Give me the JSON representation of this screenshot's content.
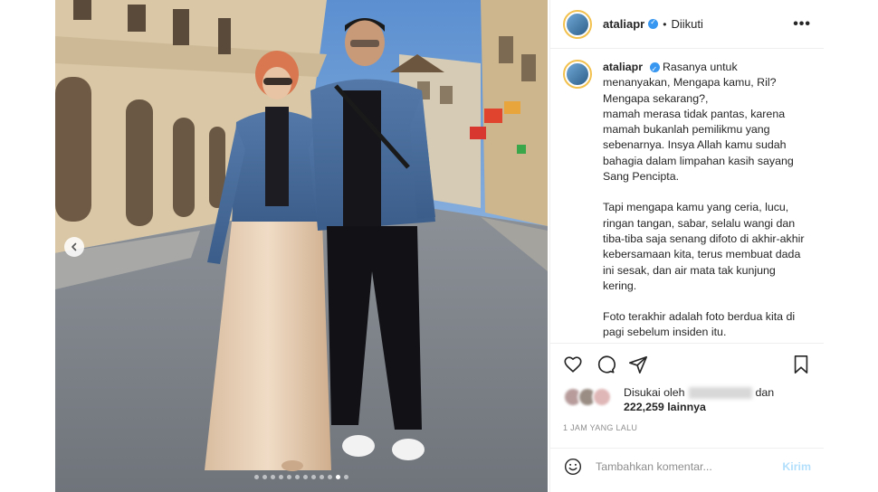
{
  "post": {
    "username": "ataliapr",
    "follow_state": "Diikuti",
    "separator": "•",
    "more_label": "•••",
    "caption": [
      "Rasanya untuk menanyakan, Mengapa kamu, Ril? Mengapa sekarang?,\nmamah merasa tidak pantas, karena mamah bukanlah pemilikmu yang sebenarnya. Insya Allah kamu sudah bahagia dalam limpahan kasih sayang Sang Pencipta.",
      "Tapi mengapa kamu yang ceria, lucu, ringan tangan, sabar, selalu wangi dan tiba-tiba saja senang difoto di akhir-akhir kebersamaan kita, terus membuat dada ini sesak, dan air mata tak kunjung kering.",
      "Foto terakhir adalah foto berdua kita di pagi sebelum insiden itu."
    ],
    "likes_prefix": "Disukai oleh",
    "likes_and": "dan",
    "likes_count": "222,259 lainnya",
    "time_ago": "1 JAM YANG LALU",
    "comment_placeholder": "Tambahkan komentar...",
    "post_button": "Kirim",
    "carousel_total": 12,
    "carousel_active": 11
  },
  "icons": {
    "verified": "verified-badge-icon",
    "like": "heart-icon",
    "comment": "comment-bubble-icon",
    "share": "paper-plane-icon",
    "save": "bookmark-icon",
    "emoji": "smiley-icon",
    "prev": "chevron-left-icon"
  },
  "colors": {
    "verified": "#3897f0",
    "post_button_disabled": "#b2dffc",
    "muted": "#8e8e8e"
  }
}
